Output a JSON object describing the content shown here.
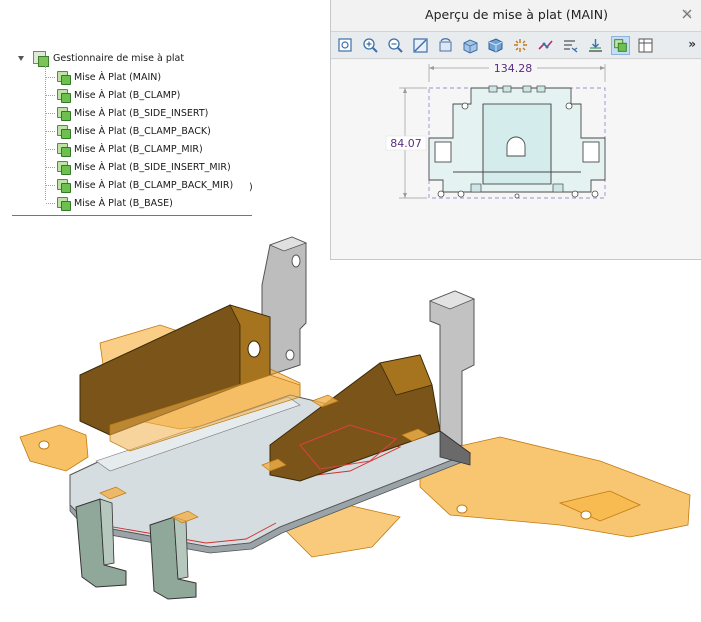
{
  "tree": {
    "root_label": "Gestionnaire de mise à plat",
    "items": [
      {
        "label": "Mise À Plat (MAIN)"
      },
      {
        "label": "Mise À Plat (B_CLAMP)"
      },
      {
        "label": "Mise À Plat (B_SIDE_INSERT)"
      },
      {
        "label": "Mise À Plat (B_CLAMP_BACK)"
      },
      {
        "label": "Mise À Plat (B_CLAMP_MIR)"
      },
      {
        "label": "Mise À Plat (B_SIDE_INSERT_MIR)"
      },
      {
        "label": "Mise À Plat (B_CLAMP_BACK_MIR)"
      },
      {
        "label": "Mise À Plat (B_BASE)"
      }
    ],
    "stray_text": ")"
  },
  "preview": {
    "title": "Aperçu de mise à plat (MAIN)",
    "close_icon": "close-icon",
    "toolbar": [
      {
        "icon": "zoom-fit-icon"
      },
      {
        "icon": "zoom-in-icon"
      },
      {
        "icon": "zoom-out-icon"
      },
      {
        "icon": "zoom-window-icon"
      },
      {
        "icon": "refresh-view-icon"
      },
      {
        "icon": "orient-view-icon"
      },
      {
        "icon": "shaded-view-icon"
      },
      {
        "icon": "explode-icon"
      },
      {
        "icon": "bend-lines-icon"
      },
      {
        "icon": "bend-table-icon"
      },
      {
        "icon": "flatten-icon"
      },
      {
        "icon": "flat-state-icon",
        "active": true
      },
      {
        "icon": "dimension-table-icon"
      }
    ],
    "more_label": "»",
    "dimensions": {
      "width": "134.28",
      "height": "84.07"
    }
  },
  "colors": {
    "flat_pattern": "#f5a623",
    "sheet_metal": "#c8c8c8",
    "dark_wall": "#6b4a14",
    "tree_accent": "#39a03a",
    "dimension_text": "#5a2d82"
  }
}
